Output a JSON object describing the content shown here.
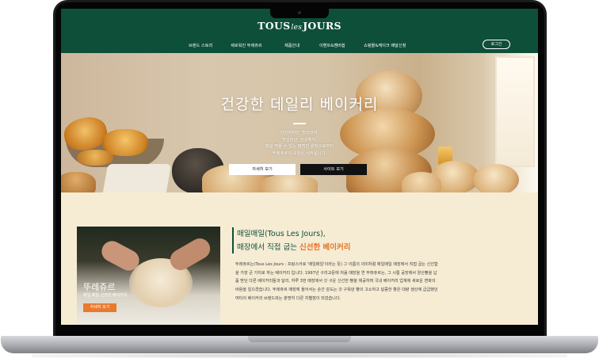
{
  "brand": {
    "name_left": "TOUS",
    "name_mid": "les",
    "name_right": "JOURS",
    "color_primary": "#0e4f3a",
    "color_accent": "#e8711f"
  },
  "nav": {
    "items": [
      "브랜드 스토리",
      "새로워진 뚜레쥬르",
      "제품안내",
      "이벤트&멤버쉽",
      "쇼핑몰&케이크 배달신청"
    ],
    "login_label": "로그인"
  },
  "hero": {
    "title": "건강한 데일리 베이커리",
    "lines": [
      "건강하지만, 맛있어야,",
      "맛있지만, 건강해야,",
      "매일 먹을 수 있는 평범한 원칙으로부터",
      "뚜레쥬르의 오늘은 시작됩니다."
    ],
    "btn_detail": "자세히 보기",
    "btn_site": "사이트 보기"
  },
  "promo": {
    "title": "뚜레쥬르",
    "subtitle": "매일 매일 신선한 베이커리",
    "button": "자세히 보기"
  },
  "about": {
    "headline_line1": "매일매일(Tous Les Jours),",
    "headline_line2_prefix": "매장에서 직접 굽는 ",
    "headline_line2_accent": "신선한 베이커리",
    "body": "뚜레쥬르는(Tous Les Jours : 프랑스어로 '매일매일'이라는 뜻) 그 이름의 의미처럼 매일매일 매장에서 직접 굽는 신선함을 가장 큰 가치로 하는 베이커리 입니다. 1997년 구리교문에 처음 매장을 연 뚜레쥬르는, 그 시절 공장에서 양산빵을 납품 받던 다른 베이커리들과 달리, 하루 3번 매장에서 갓 구운 신선한 빵을 제공하며 국내 베이커리 업계에 새로운 변화의 바람을 일으켰습니다. 뚜레쥬르 매장에 들어서는 순간 감도는 갓 구워낸 빵의 고소하고 달콤한 향은 대량 생산에 급급했던 여타의 베이커리 브랜드와는 분명히 다른 차별점이 되었습니다."
  }
}
